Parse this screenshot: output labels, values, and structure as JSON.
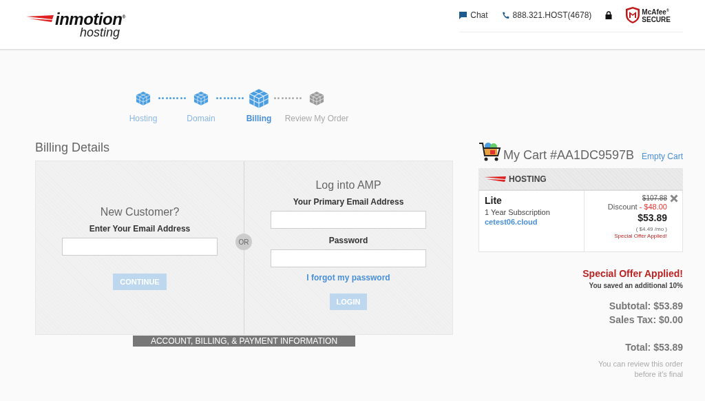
{
  "header": {
    "logo": {
      "name": "inmotion$^{®}$",
      "sub": "hosting"
    },
    "chat": "Chat",
    "phone": "888.321.HOST(4678)",
    "badge": {
      "brand": "McAfee$^{®}$",
      "sub": "SECURE"
    }
  },
  "steps": [
    {
      "label": "Hosting",
      "done": true,
      "selected": false
    },
    {
      "label": "Domain",
      "done": true,
      "selected": false
    },
    {
      "label": "Billing",
      "done": true,
      "selected": true
    },
    {
      "label": "Review My Order",
      "done": false,
      "selected": false
    }
  ],
  "billing": {
    "title": "Billing Details",
    "new_customer": {
      "heading": "New Customer?",
      "label": "Enter Your Email Address",
      "button": "CONTINUE"
    },
    "separator": "OR",
    "login": {
      "heading": "Log into AMP",
      "email_label": "Your Primary Email Address",
      "password_label": "Password",
      "forgot": "I forgot my password",
      "button": "LOGIN"
    },
    "footer_tab": "ACCOUNT, BILLING, & PAYMENT INFORMATION"
  },
  "cart": {
    "title": "My Cart #AA1DC9597B",
    "empty": "Empty Cart",
    "section": "HOSTING",
    "item": {
      "name": "Lite",
      "term": "1 Year Subscription",
      "domain": "cetest06.cloud",
      "old_price": "$107.88",
      "discount_label": "Discount",
      "discount": "- $48.00",
      "price": "$53.89",
      "monthly": "( $4.49 /mo )",
      "offer": "Special Offer Applied!"
    },
    "offer": "Special Offer Applied!",
    "saved": "You saved an additional 10%",
    "subtotal": "Subtotal: $53.89",
    "tax": "Sales Tax: $0.00",
    "total": "Total: $53.89",
    "note": "You can review this order before it's final"
  }
}
